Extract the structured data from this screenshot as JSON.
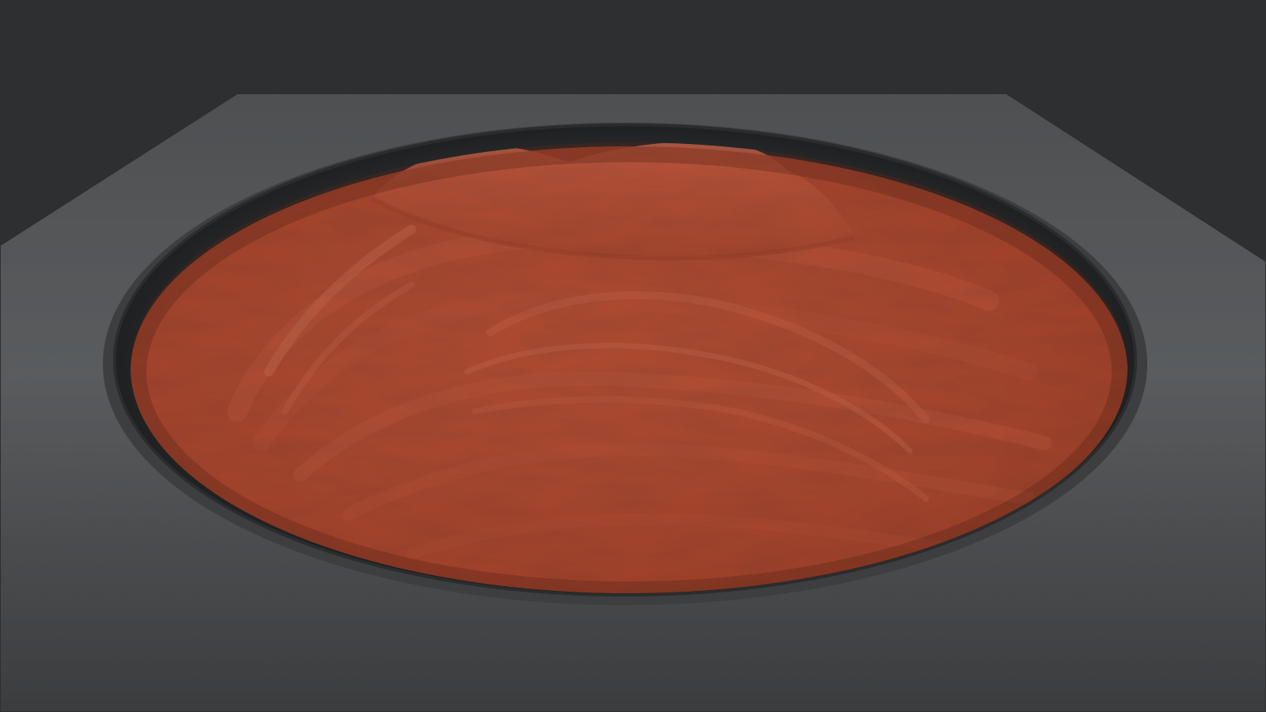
{
  "scene": {
    "subject": "terrain-render",
    "colors": {
      "background": "#2e2f31",
      "slab_top": "#585a5c",
      "slab_dark": "#3a3c3e",
      "rim_wall": "#2a2b2c",
      "terrain_base": "#8c3a28",
      "terrain_mid": "#b85a42",
      "terrain_highlight": "#e89a80",
      "terrain_shadow": "#5a2418"
    }
  }
}
